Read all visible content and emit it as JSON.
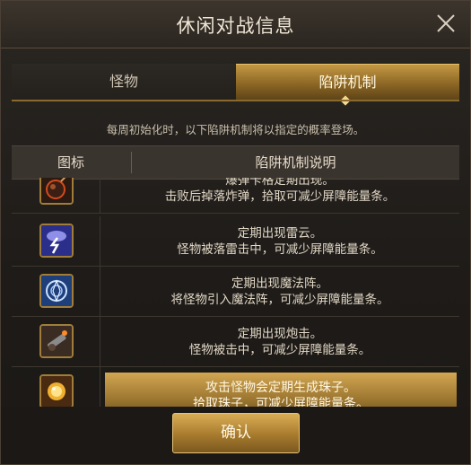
{
  "dialog": {
    "title": "休闲对战信息",
    "close_icon": "close-icon"
  },
  "tabs": [
    {
      "label": "怪物",
      "active": false
    },
    {
      "label": "陷阱机制",
      "active": true
    }
  ],
  "notice": "每周初始化时，以下陷阱机制将以指定的概率登场。",
  "table": {
    "headers": {
      "icon": "图标",
      "description": "陷阱机制说明"
    },
    "rows": [
      {
        "icon": "bomb-icon",
        "lines": [
          "爆弹卡格定期出现。",
          "击败后掉落炸弹，拾取可减少屏障能量条。"
        ]
      },
      {
        "icon": "thunder-cloud-icon",
        "lines": [
          "定期出现雷云。",
          "怪物被落雷击中，可减少屏障能量条。"
        ]
      },
      {
        "icon": "magic-circle-icon",
        "lines": [
          "定期出现魔法阵。",
          "将怪物引入魔法阵，可减少屏障能量条。"
        ]
      },
      {
        "icon": "cannon-icon",
        "lines": [
          "定期出现炮击。",
          "怪物被击中，可减少屏障能量条。"
        ]
      },
      {
        "icon": "orb-icon",
        "lines": [
          "攻击怪物会定期生成珠子。",
          "拾取珠子，可减少屏障能量条。"
        ],
        "highlighted": true
      }
    ]
  },
  "confirm_label": "确认",
  "colors": {
    "accent_gold": "#c49844",
    "text_light": "#e2d8c6",
    "panel_dark": "#1e1b18"
  }
}
